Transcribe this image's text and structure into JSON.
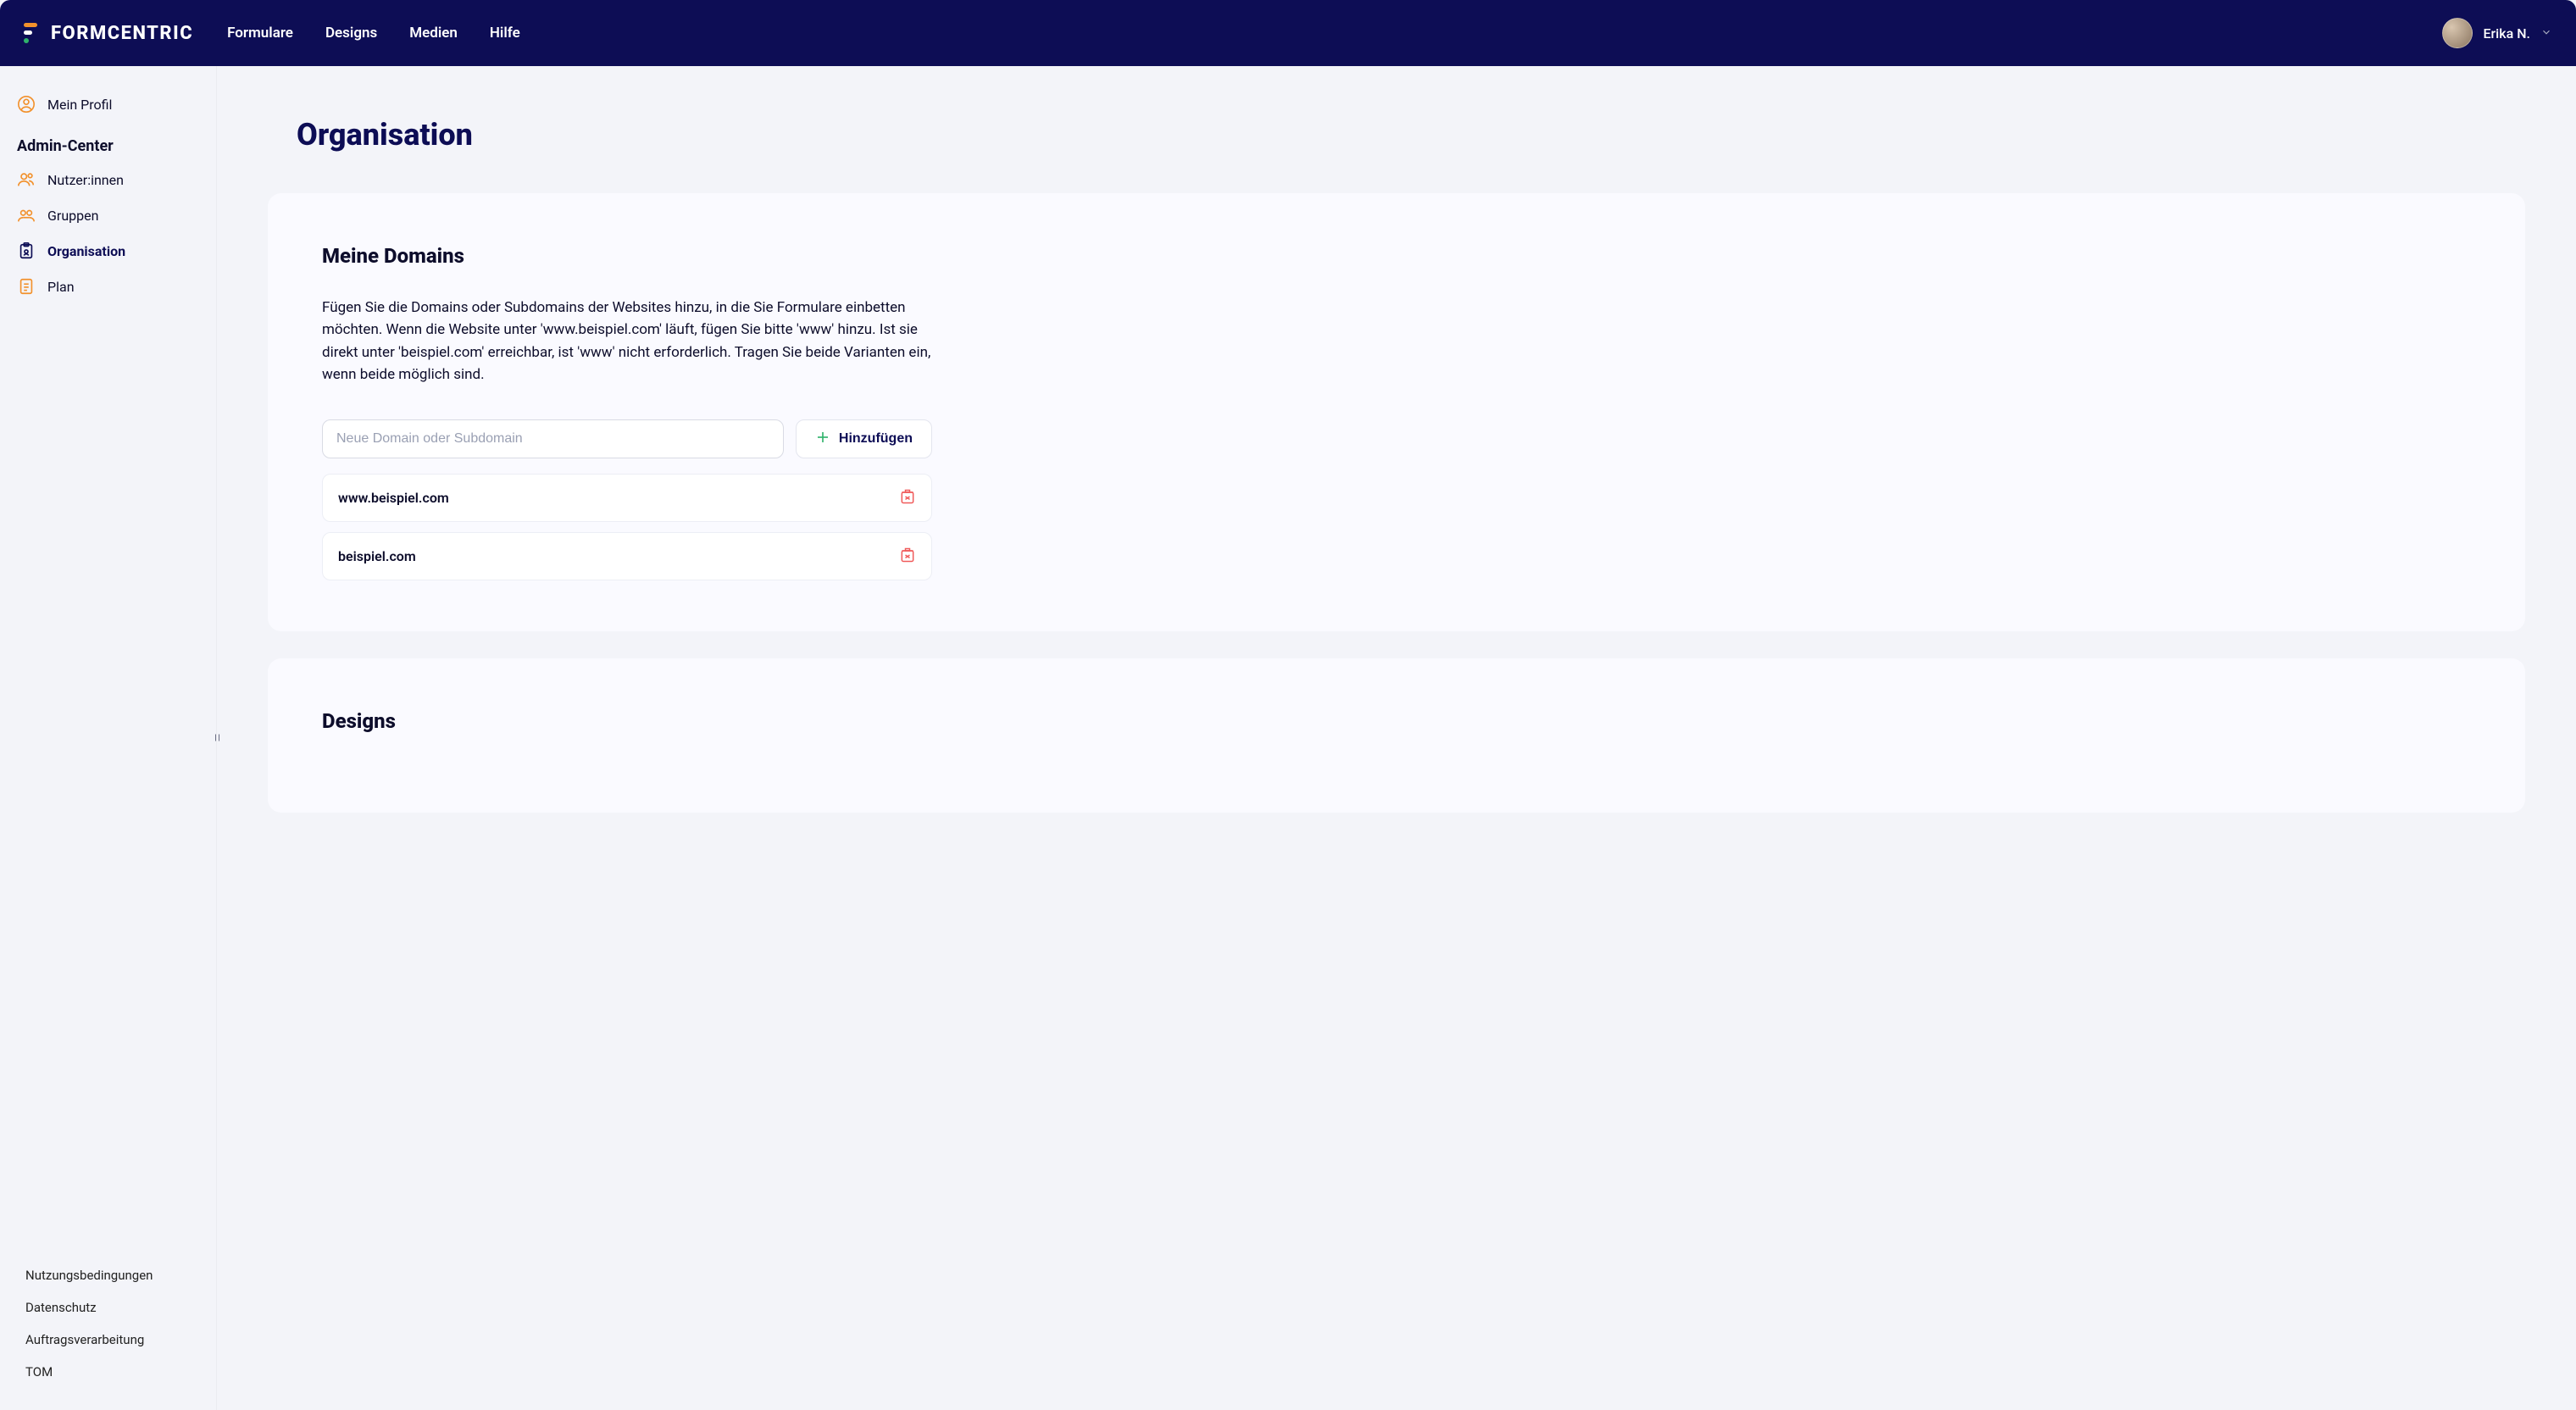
{
  "brand": "FORMCENTRIC",
  "topnav": {
    "items": [
      {
        "label": "Formulare"
      },
      {
        "label": "Designs"
      },
      {
        "label": "Medien"
      },
      {
        "label": "Hilfe"
      }
    ]
  },
  "user": {
    "name": "Erika N."
  },
  "sidebar": {
    "profile_label": "Mein Profil",
    "section_header": "Admin-Center",
    "items": [
      {
        "label": "Nutzer:innen",
        "icon": "users"
      },
      {
        "label": "Gruppen",
        "icon": "group"
      },
      {
        "label": "Organisation",
        "icon": "clipboard",
        "active": true
      },
      {
        "label": "Plan",
        "icon": "document"
      }
    ],
    "footer": [
      {
        "label": "Nutzungsbedingungen"
      },
      {
        "label": "Datenschutz"
      },
      {
        "label": "Auftragsverarbeitung"
      },
      {
        "label": "TOM"
      }
    ]
  },
  "page": {
    "title": "Organisation",
    "domains": {
      "heading": "Meine Domains",
      "description": "Fügen Sie die Domains oder Subdomains der Websites hinzu, in die Sie Formulare einbetten möchten. Wenn die Website unter 'www.beispiel.com' läuft, fügen Sie bitte 'www' hinzu. Ist sie direkt unter 'beispiel.com' erreichbar, ist 'www' nicht erforderlich. Tragen Sie beide Varianten ein, wenn beide möglich sind.",
      "input_placeholder": "Neue Domain oder Subdomain",
      "add_button": "Hinzufügen",
      "list": [
        {
          "domain": "www.beispiel.com"
        },
        {
          "domain": "beispiel.com"
        }
      ]
    },
    "designs": {
      "heading": "Designs"
    }
  }
}
